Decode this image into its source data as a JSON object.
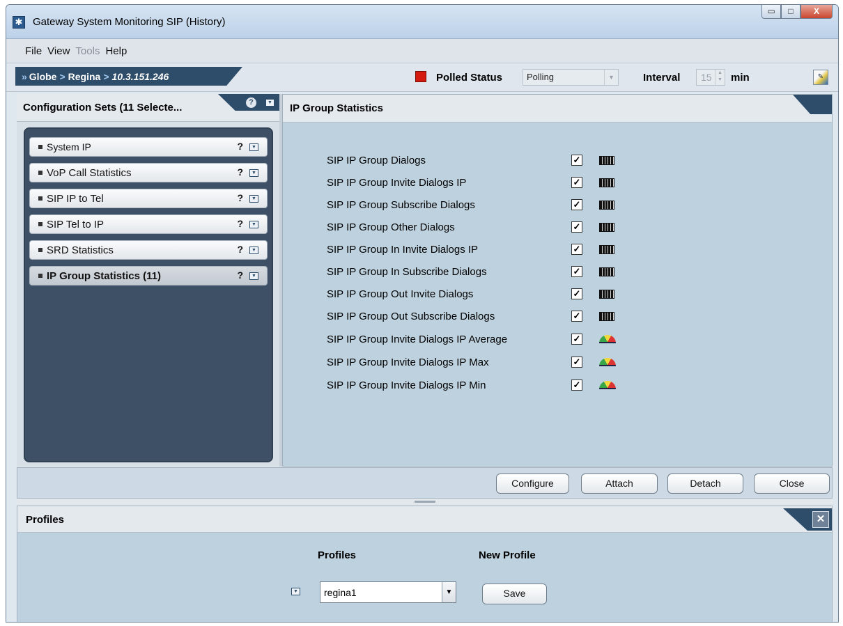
{
  "window": {
    "title": "Gateway System Monitoring SIP (History)",
    "controls": {
      "minimize": "▭",
      "maximize": "□",
      "close": "X"
    }
  },
  "menu": [
    "File",
    "View",
    "Tools",
    "Help"
  ],
  "breadcrumb": {
    "prefix": "»",
    "items": [
      "Globe",
      "Regina"
    ],
    "separator": ">",
    "current": "10.3.151.246"
  },
  "toolbar": {
    "status_color": "#d51a0f",
    "polled_status_label": "Polled Status",
    "polled_status_value": "Polling",
    "interval_label": "Interval",
    "interval_value": "15",
    "interval_unit": "min"
  },
  "config_sets": {
    "title": "Configuration Sets (11 Selecte...",
    "items": [
      {
        "label": "System IP",
        "help": "?"
      },
      {
        "label": "VoP Call Statistics",
        "help": "?"
      },
      {
        "label": "SIP IP to Tel",
        "help": "?"
      },
      {
        "label": "SIP Tel to IP",
        "help": "?"
      },
      {
        "label": "SRD Statistics",
        "help": "?"
      },
      {
        "label": "IP Group Statistics (11)",
        "help": "?"
      }
    ]
  },
  "ip_group": {
    "title": "IP Group Statistics",
    "rows": [
      {
        "label": "SIP IP Group Dialogs",
        "checked": "✓",
        "icon": "bar-graph-icon"
      },
      {
        "label": "SIP IP Group Invite Dialogs IP",
        "checked": "✓",
        "icon": "bar-graph-icon"
      },
      {
        "label": "SIP IP Group Subscribe Dialogs",
        "checked": "✓",
        "icon": "bar-graph-icon"
      },
      {
        "label": "SIP IP Group Other Dialogs",
        "checked": "✓",
        "icon": "bar-graph-icon"
      },
      {
        "label": "SIP IP Group In Invite Dialogs IP",
        "checked": "✓",
        "icon": "bar-graph-icon"
      },
      {
        "label": "SIP IP Group In Subscribe Dialogs",
        "checked": "✓",
        "icon": "bar-graph-icon"
      },
      {
        "label": "SIP IP Group Out Invite Dialogs",
        "checked": "✓",
        "icon": "bar-graph-icon"
      },
      {
        "label": "SIP IP Group Out Subscribe Dialogs",
        "checked": "✓",
        "icon": "bar-graph-icon"
      },
      {
        "label": "SIP IP Group Invite Dialogs IP Average",
        "checked": "✓",
        "icon": "gauge-icon"
      },
      {
        "label": "SIP IP Group Invite Dialogs IP Max",
        "checked": "✓",
        "icon": "gauge-icon"
      },
      {
        "label": "SIP IP Group Invite Dialogs IP Min",
        "checked": "✓",
        "icon": "gauge-icon"
      }
    ]
  },
  "actions": {
    "configure": "Configure",
    "attach": "Attach",
    "detach": "Detach",
    "close": "Close"
  },
  "profiles": {
    "title": "Profiles",
    "profiles_label": "Profiles",
    "new_profile_label": "New Profile",
    "selected_profile": "regina1",
    "save": "Save"
  }
}
